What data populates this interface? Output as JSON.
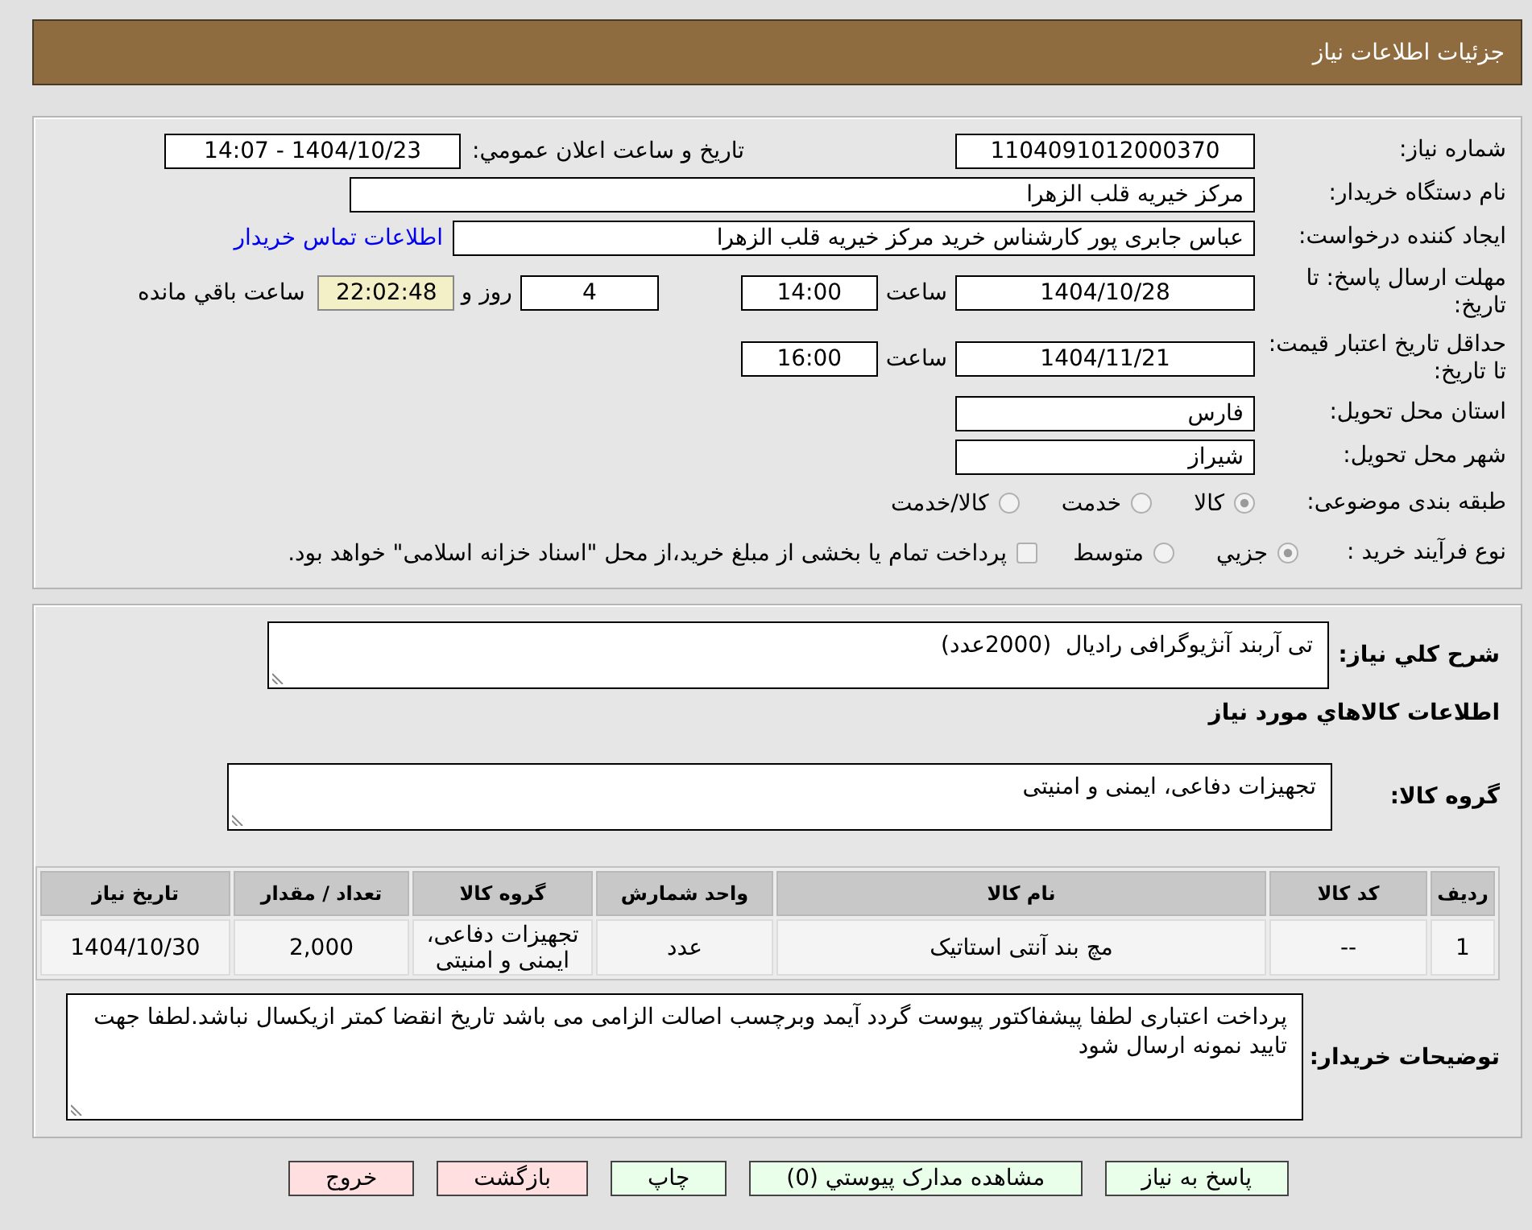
{
  "header": {
    "title": "جزئیات اطلاعات نیاز"
  },
  "details": {
    "need_number": {
      "label": "شماره نیاز:",
      "value": "1104091012000370"
    },
    "announcement": {
      "label": "تاریخ و ساعت اعلان عمومي:",
      "value": "1404/10/23 - 14:07"
    },
    "buyer": {
      "label": "نام دستگاه خریدار:",
      "value": "مرکز خیریه قلب الزهرا"
    },
    "requester": {
      "label": "ایجاد کننده درخواست:",
      "value": "عباس جابری پور کارشناس خرید مرکز خیریه قلب الزهرا",
      "link": "اطلاعات تماس خریدار"
    },
    "reply_deadline": {
      "label": "مهلت ارسال پاسخ: تا تاریخ:",
      "date": "1404/10/28",
      "time_label": "ساعت",
      "time": "14:00",
      "days": "4",
      "days_label": "روز و",
      "remaining": "22:02:48",
      "remaining_label": "ساعت باقي مانده"
    },
    "price_validity": {
      "label": "حداقل تاریخ اعتبار قیمت: تا تاریخ:",
      "date": "1404/11/21",
      "time_label": "ساعت",
      "time": "16:00"
    },
    "province": {
      "label": "استان محل تحویل:",
      "value": "فارس"
    },
    "city": {
      "label": "شهر محل تحویل:",
      "value": "شیراز"
    },
    "category": {
      "label": "طبقه بندی موضوعی:",
      "options": [
        {
          "label": "كالا",
          "selected": true
        },
        {
          "label": "خدمت",
          "selected": false
        },
        {
          "label": "كالا/خدمت",
          "selected": false
        }
      ]
    },
    "process": {
      "label": "نوع فرآیند خرید :",
      "options": [
        {
          "label": "جزيي",
          "selected": true
        },
        {
          "label": "متوسط",
          "selected": false
        }
      ],
      "treasury": {
        "label": "پرداخت تمام یا بخشی از مبلغ خرید،از محل \"اسناد خزانه اسلامی\" خواهد بود.",
        "checked": false
      }
    }
  },
  "goods": {
    "summary": {
      "label": "شرح كلي نیاز:",
      "value": "تی آربند آنژیوگرافی رادیال  (2000عدد)"
    },
    "section_title": "اطلاعات كالاهاي مورد نیاز",
    "group": {
      "label": "گروه كالا:",
      "value": "تجهیزات دفاعی، ایمنی و امنیتی"
    },
    "table": {
      "columns": [
        "ردیف",
        "کد کالا",
        "نام کالا",
        "واحد شمارش",
        "گروه کالا",
        "تعداد / مقدار",
        "تاریخ نیاز"
      ],
      "rows": [
        [
          "1",
          "--",
          "مچ بند آنتی استاتیک",
          "عدد",
          "تجهیزات دفاعی، ایمنی و امنیتی",
          "2,000",
          "1404/10/30"
        ]
      ]
    },
    "buyer_notes": {
      "label": "توضیحات خریدار:",
      "value": "پرداخت اعتباری لطفا پیشفاکتور پیوست گردد آیمد وبرچسب اصالت الزامی می باشد تاریخ انقضا کمتر ازیکسال نباشد.لطفا جهت تایید نمونه ارسال شود"
    }
  },
  "buttons": [
    {
      "label": "پاسخ به نیاز",
      "kind": "action"
    },
    {
      "label": "مشاهده مدارک پیوستي (0)",
      "kind": "action"
    },
    {
      "label": "چاپ",
      "kind": "action"
    },
    {
      "label": "بازگشت",
      "kind": "exit"
    },
    {
      "label": "خروج",
      "kind": "exit"
    }
  ]
}
